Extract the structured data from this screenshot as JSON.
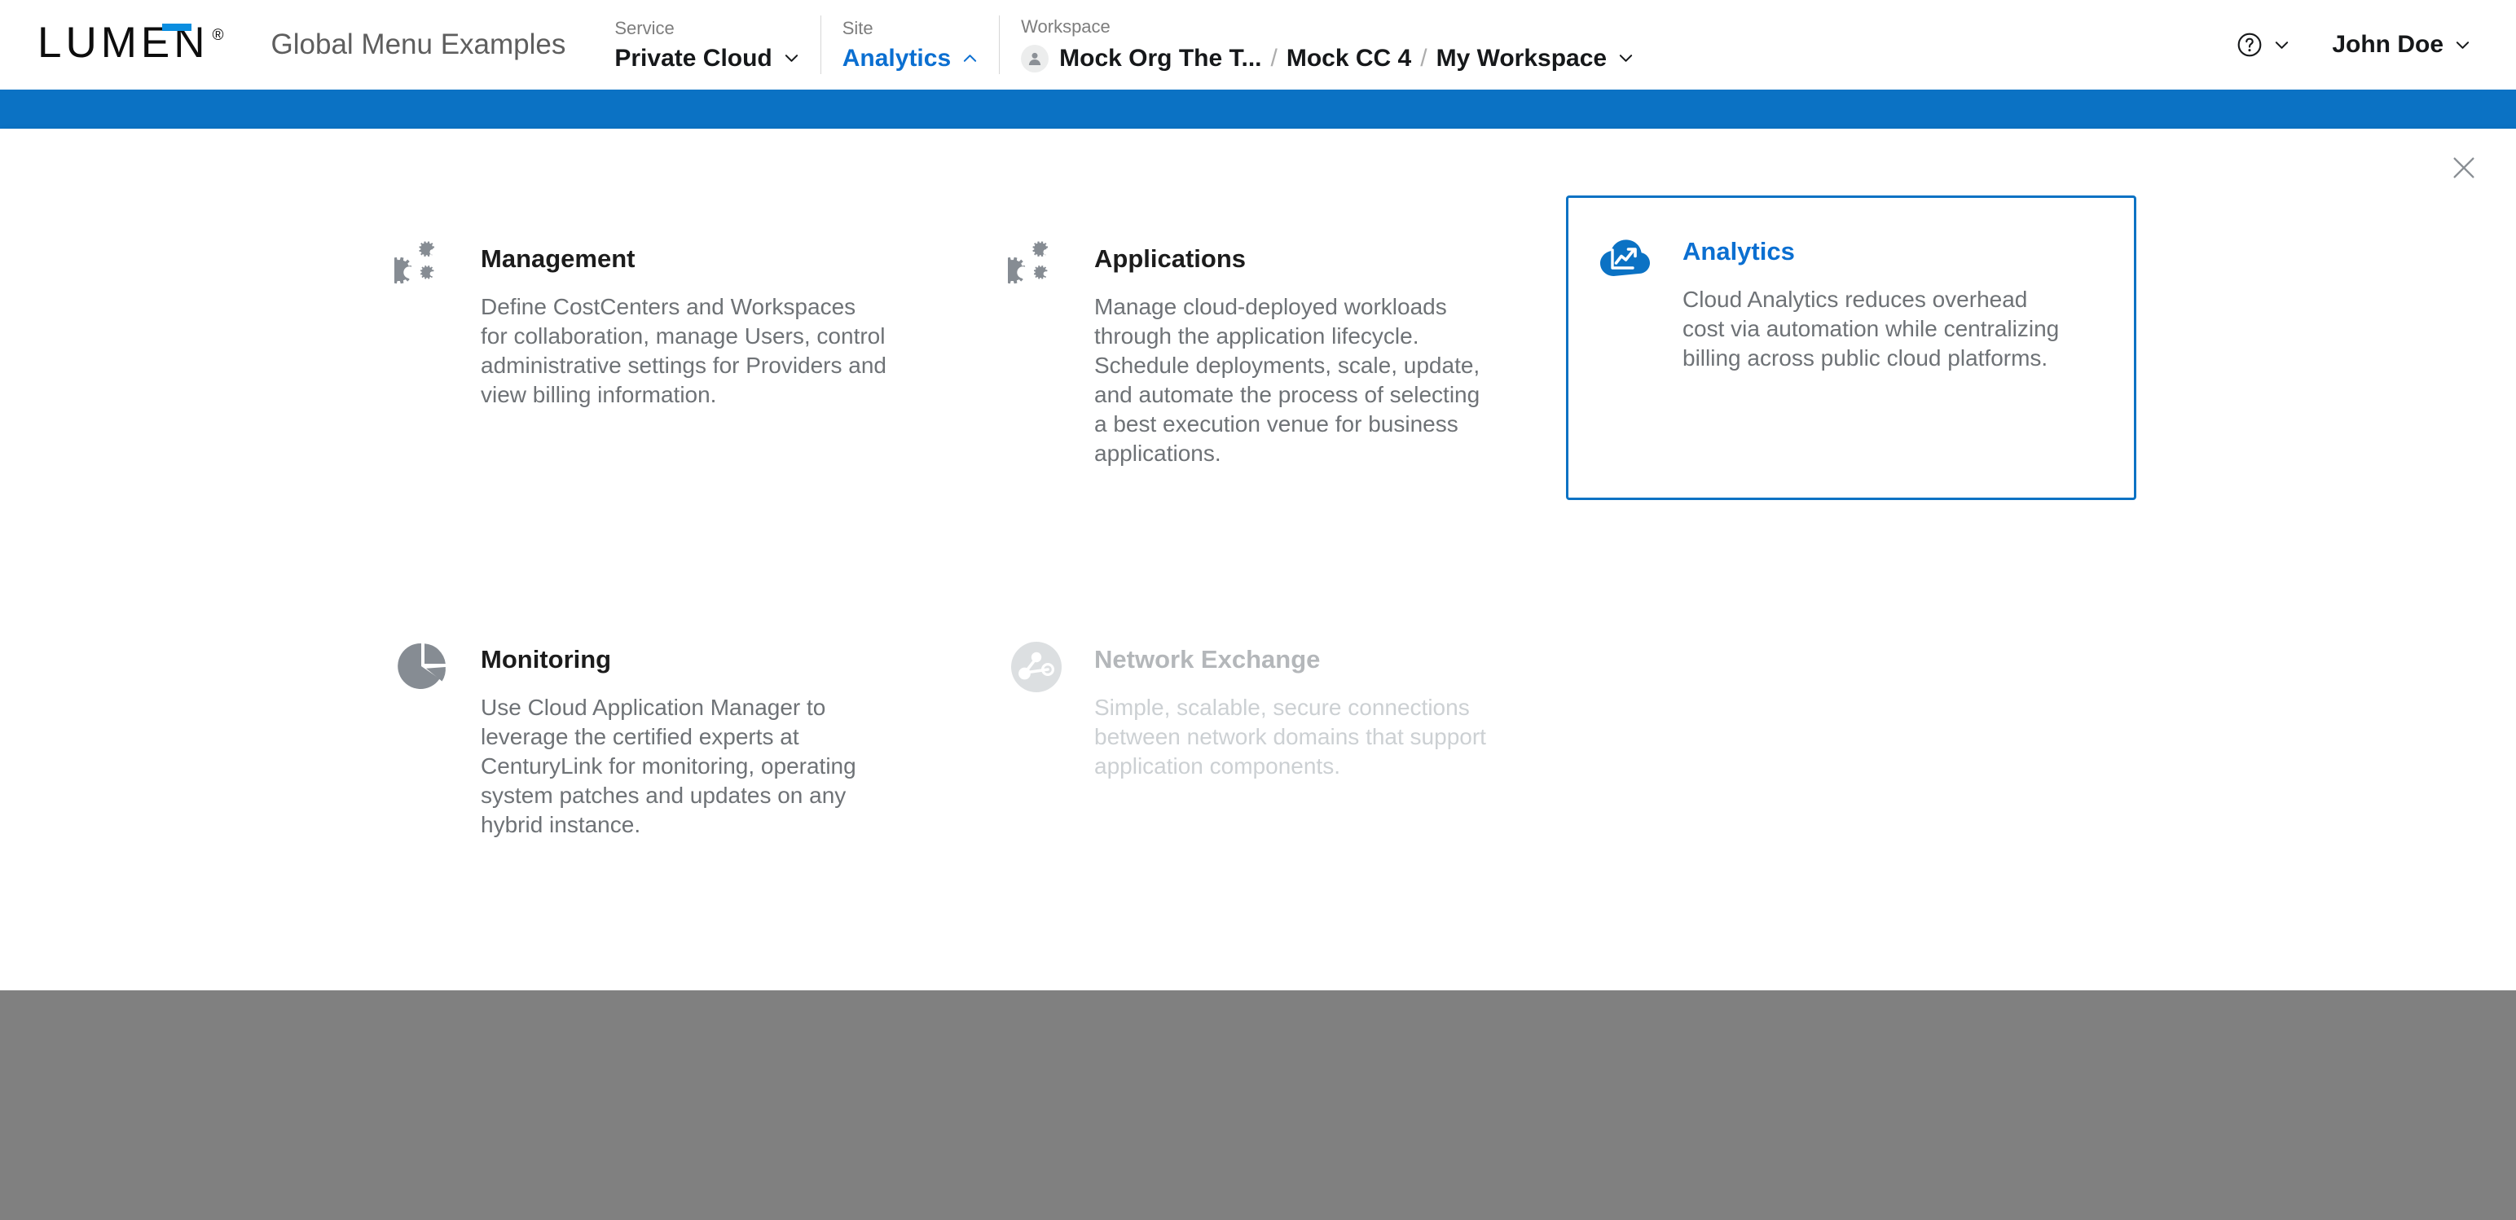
{
  "header": {
    "logo_text": "LUMEN",
    "logo_registered": "®",
    "app_title": "Global Menu Examples",
    "selectors": [
      {
        "label": "Service",
        "value": "Private Cloud",
        "state": "collapsed"
      },
      {
        "label": "Site",
        "value": "Analytics",
        "state": "expanded"
      }
    ],
    "workspace": {
      "label": "Workspace",
      "avatar_icon": "person-avatar-icon",
      "crumbs": [
        "Mock Org The T...",
        "Mock CC 4",
        "My Workspace"
      ],
      "separator": "/"
    },
    "help": {
      "icon": "help-circle-icon",
      "chevron": "chevron-down-icon"
    },
    "user": {
      "name": "John Doe",
      "chevron": "chevron-down-icon"
    }
  },
  "panel": {
    "close_icon": "close-icon",
    "accent_color": "#0b72c4",
    "cards": [
      {
        "id": "management",
        "title": "Management",
        "description": "Define CostCenters and Workspaces for collaboration, manage Users, control administrative settings for Providers and view billing information.",
        "icon": "gears-icon",
        "selected": false,
        "disabled": false
      },
      {
        "id": "applications",
        "title": "Applications",
        "description": "Manage cloud-deployed workloads through the application lifecycle. Schedule deployments, scale, update, and automate the process of selecting a best execution venue for business applications.",
        "icon": "gears-icon",
        "selected": false,
        "disabled": false
      },
      {
        "id": "analytics",
        "title": "Analytics",
        "description": "Cloud Analytics reduces overhead cost via automation while centralizing billing across public cloud platforms.",
        "icon": "cloud-analytics-icon",
        "selected": true,
        "disabled": false
      },
      {
        "id": "monitoring",
        "title": "Monitoring",
        "description": "Use Cloud Application Manager to leverage the certified experts at CenturyLink for monitoring, operating system patches and updates on any hybrid instance.",
        "icon": "pie-chart-icon",
        "selected": false,
        "disabled": false
      },
      {
        "id": "network-exchange",
        "title": "Network Exchange",
        "description": "Simple, scalable, secure connections between network domains that support application components.",
        "icon": "network-nodes-icon",
        "selected": false,
        "disabled": true
      }
    ]
  },
  "colors": {
    "brand_blue": "#0b72c4",
    "link_blue": "#0b6fd1",
    "logo_bar_blue": "#0b8ee0",
    "text_dark": "#16181a",
    "text_muted": "#6e7276",
    "text_disabled": "#ccd0d3",
    "scrim_gray": "#808080"
  }
}
